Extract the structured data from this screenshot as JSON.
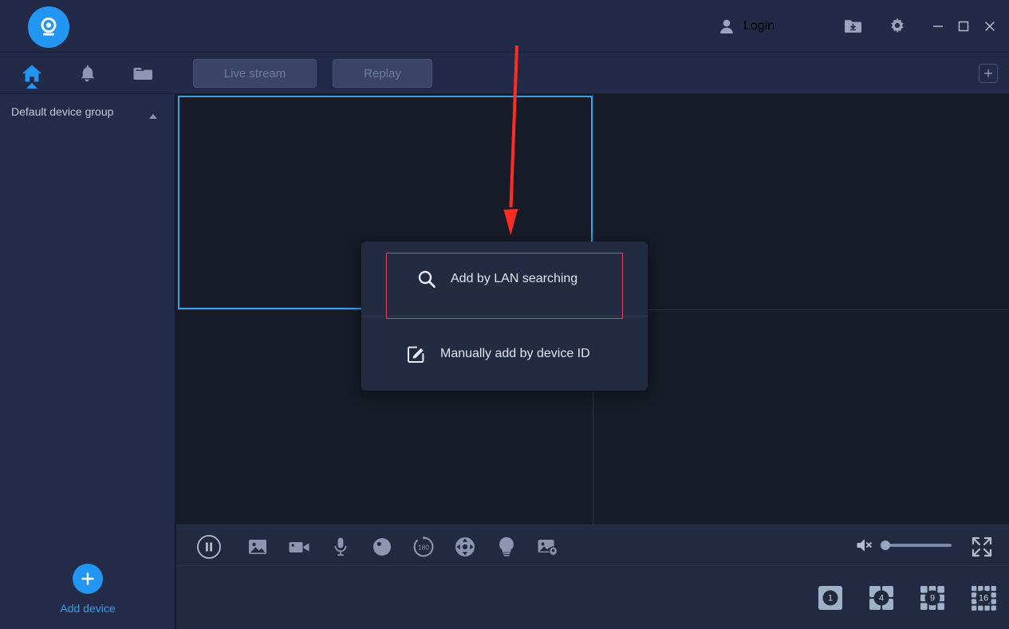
{
  "app": {
    "logo_icon": "camera-logo-icon",
    "accent_color": "#2196f3",
    "background_color": "#161b27",
    "panel_color": "#222a47",
    "annotation_color": "#ff2d1f",
    "highlight_color": "#e0485f"
  },
  "titlebar": {
    "login_label": "Login",
    "user_icon": "user-icon",
    "download_icon": "download-folder-icon",
    "settings_icon": "gear-icon",
    "minimize_icon": "minimize-icon",
    "maximize_icon": "maximize-icon",
    "close_icon": "close-icon"
  },
  "leftnav": {
    "items": [
      {
        "name": "home",
        "icon": "home-icon",
        "active": true
      },
      {
        "name": "alarm",
        "icon": "bell-icon",
        "active": false
      },
      {
        "name": "files",
        "icon": "folder-icon",
        "active": false
      }
    ]
  },
  "sidebar": {
    "group_label": "Default device group",
    "group_caret_icon": "chevron-up-icon",
    "add_device_label": "Add device",
    "add_device_icon": "plus-icon"
  },
  "tabbar": {
    "tabs": [
      {
        "label": "Live stream",
        "active": false
      },
      {
        "label": "Replay",
        "active": false
      }
    ],
    "add_tab_icon": "plus-square-icon"
  },
  "video": {
    "layout": "2x2",
    "panes": [
      {
        "index": 1,
        "selected": true
      },
      {
        "index": 2,
        "selected": false
      },
      {
        "index": 3,
        "selected": false
      },
      {
        "index": 4,
        "selected": false
      }
    ]
  },
  "controls": {
    "buttons": [
      {
        "name": "pause",
        "icon": "pause-circle-icon"
      },
      {
        "name": "snapshot",
        "icon": "image-icon"
      },
      {
        "name": "record",
        "icon": "video-camera-icon"
      },
      {
        "name": "microphone",
        "icon": "microphone-icon"
      },
      {
        "name": "fisheye",
        "icon": "fisheye-sphere-icon"
      },
      {
        "name": "rotate-180",
        "icon": "rotate-180-icon",
        "label": "180"
      },
      {
        "name": "ptz",
        "icon": "ptz-pad-icon"
      },
      {
        "name": "light",
        "icon": "light-bulb-icon"
      },
      {
        "name": "image-settings",
        "icon": "image-settings-icon"
      }
    ],
    "volume": {
      "icon": "speaker-muted-icon",
      "muted": true,
      "level": 0
    },
    "fullscreen_icon": "fullscreen-expand-icon"
  },
  "layouts": [
    {
      "label": "1",
      "cells": 1,
      "active": false
    },
    {
      "label": "4",
      "cells": 4,
      "active": false
    },
    {
      "label": "9",
      "cells": 9,
      "active": false
    },
    {
      "label": "16",
      "cells": 16,
      "active": false
    }
  ],
  "popup": {
    "items": [
      {
        "label": "Add by LAN searching",
        "icon": "search-icon",
        "highlighted": true
      },
      {
        "label": "Manually add by device ID",
        "icon": "edit-square-icon",
        "highlighted": false
      }
    ]
  },
  "annotation": {
    "arrow_icon": "down-arrow-annotation",
    "direction": "down"
  }
}
